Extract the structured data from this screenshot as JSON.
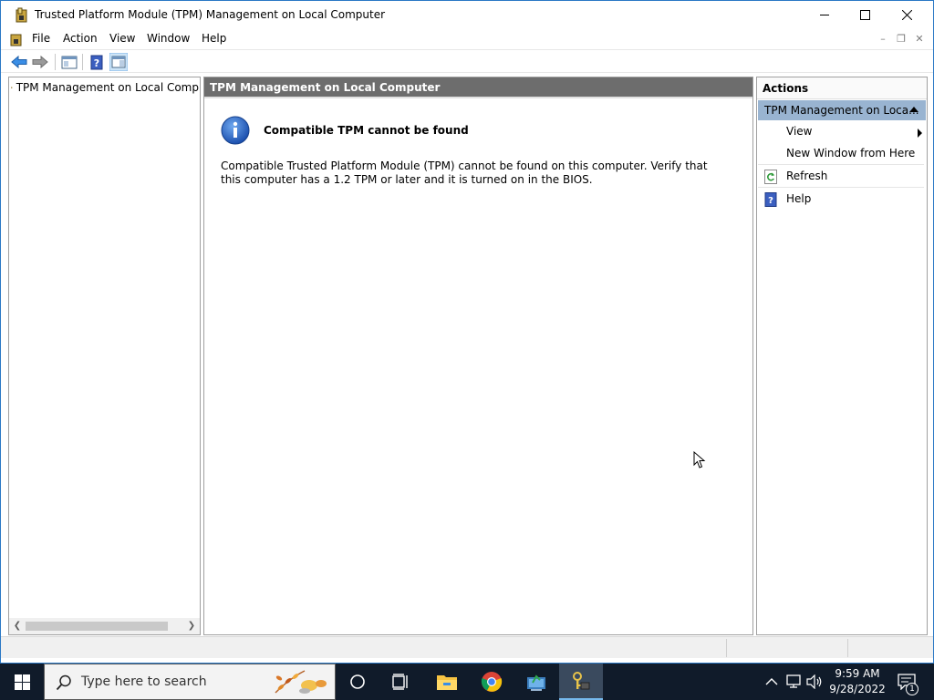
{
  "window": {
    "title": "Trusted Platform Module (TPM) Management on Local Computer"
  },
  "menu": {
    "items": [
      "File",
      "Action",
      "View",
      "Window",
      "Help"
    ]
  },
  "tree": {
    "root_label": "TPM Management on Local Comp"
  },
  "content": {
    "header": "TPM Management on Local Computer",
    "message_title": "Compatible TPM cannot be found",
    "message_body": "Compatible Trusted Platform Module (TPM) cannot be found on this computer. Verify that this computer has a 1.2 TPM or later and it is turned on in the BIOS."
  },
  "actions": {
    "header": "Actions",
    "group_label": "TPM Management on Loca...",
    "items": [
      {
        "label": "View",
        "icon": "none",
        "submenu": true
      },
      {
        "label": "New Window from Here",
        "icon": "none",
        "submenu": false
      },
      {
        "label": "Refresh",
        "icon": "refresh-icon",
        "submenu": false
      },
      {
        "label": "Help",
        "icon": "help-icon",
        "submenu": false
      }
    ]
  },
  "taskbar": {
    "search_placeholder": "Type here to search",
    "time": "9:59 AM",
    "date": "9/28/2022",
    "notification_count": "1"
  },
  "colors": {
    "content_header_bg": "#6d6d6d",
    "action_group_bg": "#99b4d1",
    "taskbar_bg": "#101b2a",
    "accent": "#1e73c8"
  }
}
